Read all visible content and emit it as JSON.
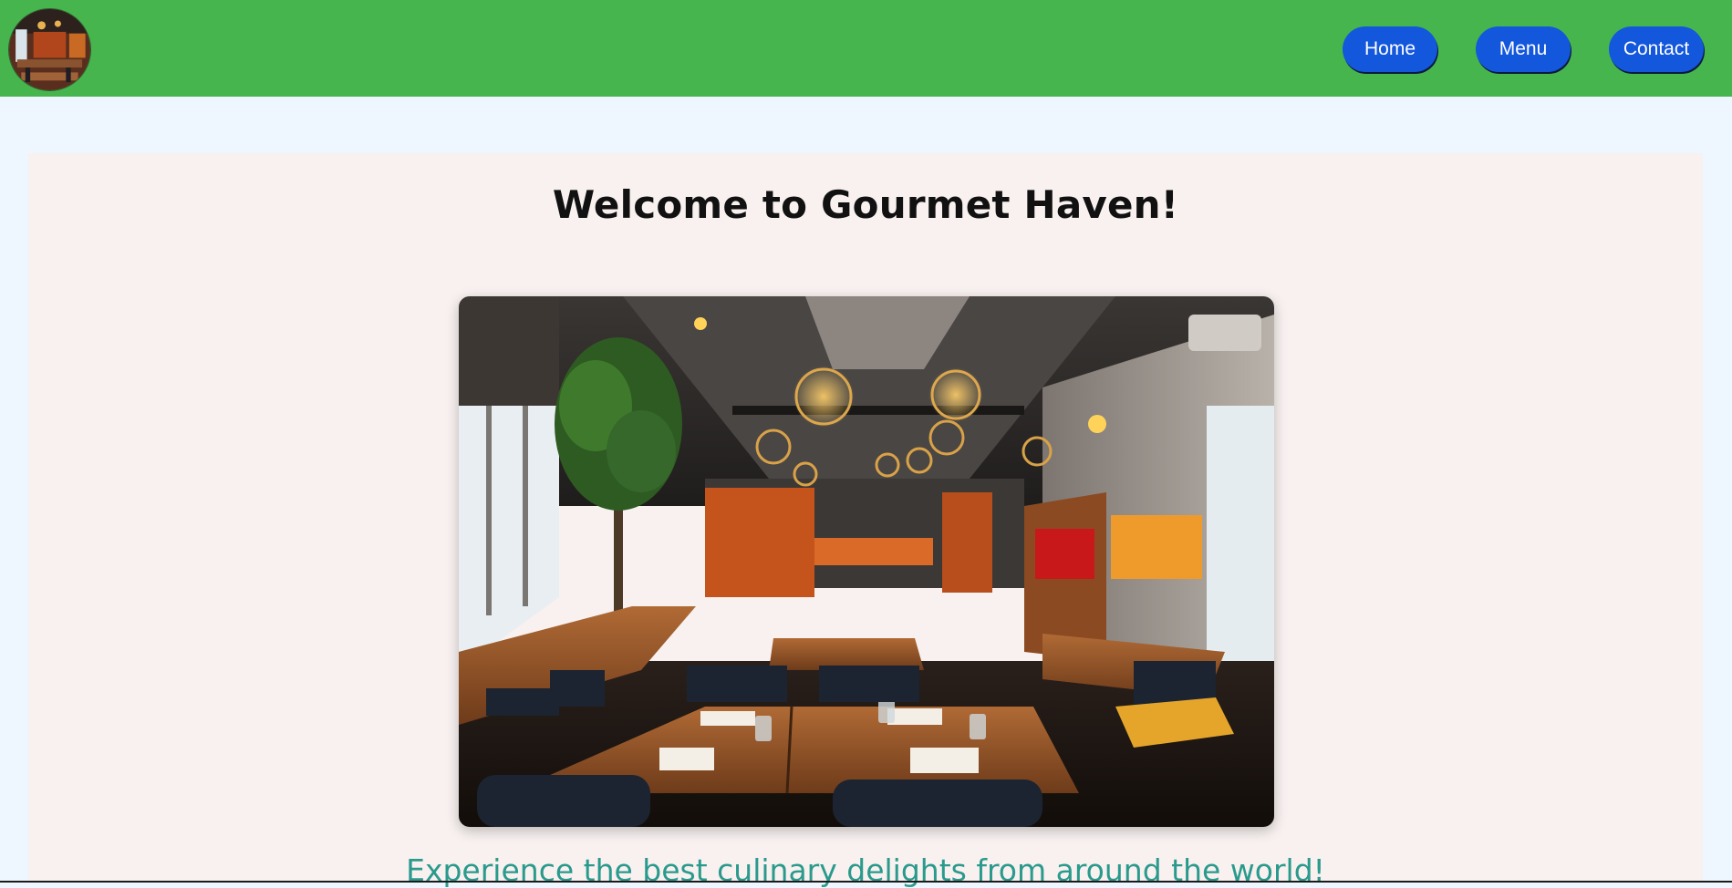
{
  "nav": {
    "logo_icon": "restaurant-logo-image",
    "buttons": [
      {
        "label": "Home"
      },
      {
        "label": "Menu"
      },
      {
        "label": "Contact"
      }
    ]
  },
  "main": {
    "title": "Welcome to Gourmet Haven!",
    "hero_image": "restaurant-interior-image",
    "tagline": "Experience the best culinary delights from around the world!"
  },
  "colors": {
    "navbar": "#47b54d",
    "nav_button": "#1357dc",
    "page_background": "#eef6ff",
    "content_background": "#f8f1f0",
    "tagline": "#2a9a8c"
  }
}
